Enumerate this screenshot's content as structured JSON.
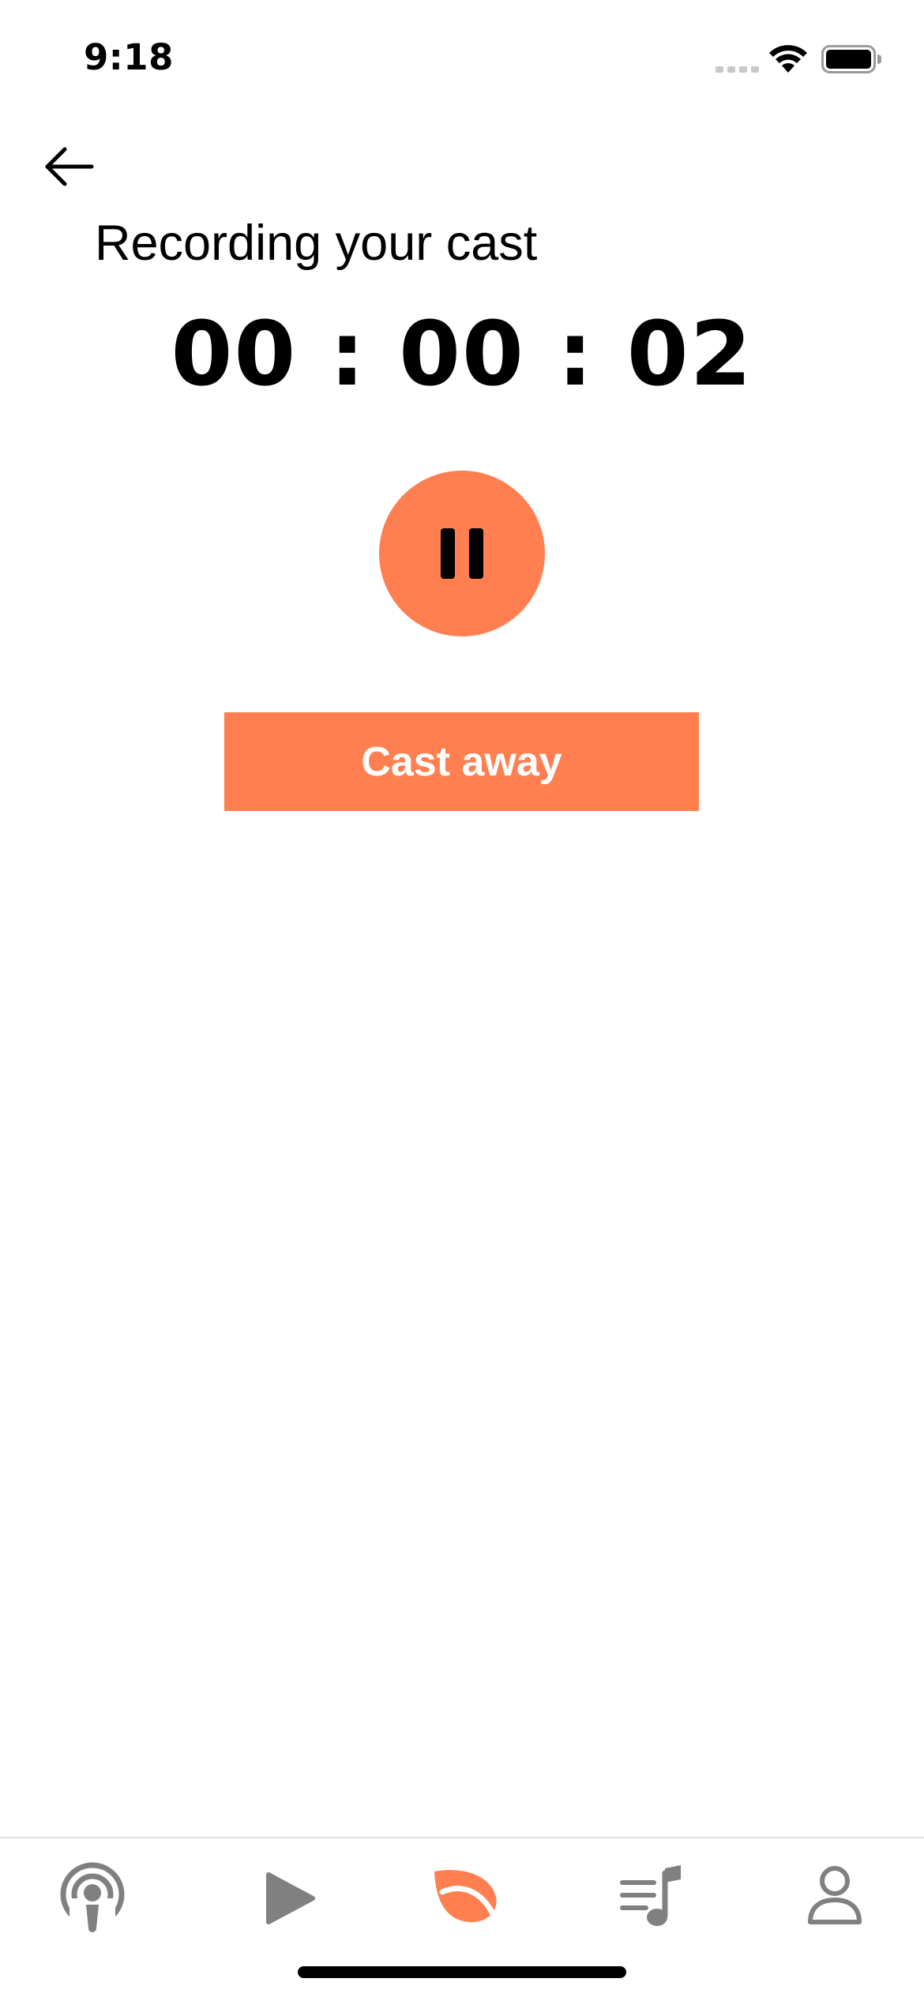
{
  "status_bar": {
    "time": "9:18"
  },
  "header": {
    "back_icon": "arrow-left-icon",
    "title": "Recording your cast"
  },
  "recorder": {
    "timer": "00 : 00 : 02",
    "pause_icon": "pause-icon",
    "cast_button_label": "Cast away"
  },
  "tab_bar": {
    "tabs": [
      {
        "icon": "podcast-icon",
        "active": false
      },
      {
        "icon": "play-icon",
        "active": false
      },
      {
        "icon": "leaf-icon",
        "active": true
      },
      {
        "icon": "playlist-icon",
        "active": false
      },
      {
        "icon": "profile-icon",
        "active": false
      }
    ]
  },
  "colors": {
    "accent": "#ff7f50",
    "tab_inactive": "#808080",
    "text": "#000000",
    "background": "#ffffff"
  }
}
